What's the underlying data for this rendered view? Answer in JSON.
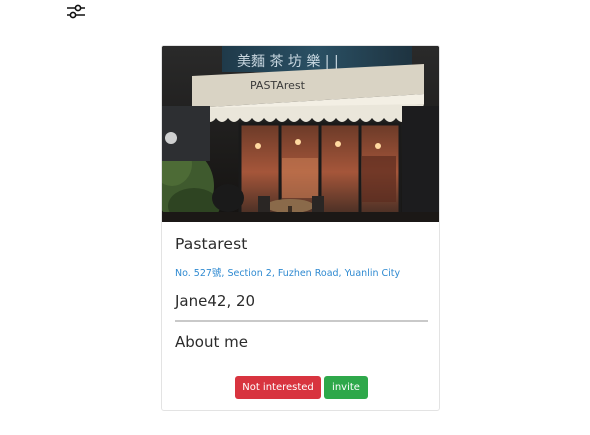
{
  "toolbar": {
    "filter_icon": "sliders-icon"
  },
  "card": {
    "photo_alt": "Pastarest storefront",
    "photo_sign_text": "PASTArest",
    "restaurant_name": "Pastarest",
    "address": "No. 527號, Section 2, Fuzhen Road, Yuanlin City",
    "user_line": "Jane42, 20",
    "about_heading": "About me",
    "buttons": {
      "not_interested": "Not interested",
      "invite": "invite"
    },
    "colors": {
      "address_link": "#2f8ad1",
      "not_interested_bg": "#d8343f",
      "invite_bg": "#2ea84a"
    }
  }
}
